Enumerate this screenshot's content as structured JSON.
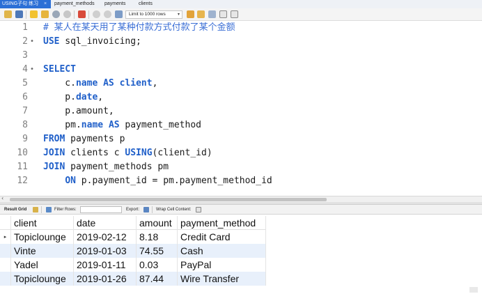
{
  "tabs": [
    {
      "label": "USING子句 练习",
      "active": true,
      "close": "×"
    },
    {
      "label": "payment_methods",
      "active": false
    },
    {
      "label": "payments",
      "active": false
    },
    {
      "label": "clients",
      "active": false
    }
  ],
  "toolbar": {
    "limit_label": "Limit to 1000 rows",
    "icons": [
      "folder-open-icon",
      "save-icon",
      "execute-icon",
      "execute-current-icon",
      "explain-icon",
      "stop-icon",
      "toggle-autocommit-icon",
      "commit-icon",
      "rollback-icon",
      "toggle-output-icon",
      "beautify-icon",
      "find-icon",
      "invisible-chars-icon",
      "wrap-icon"
    ]
  },
  "editor": {
    "lines": [
      {
        "n": "1",
        "fold": "",
        "html": "<span class='cm'># 某人在某天用了某种付款方式付款了某个金额</span>"
      },
      {
        "n": "2",
        "fold": "•",
        "html": "<span class='kw'>USE</span> sql_invoicing;"
      },
      {
        "n": "3",
        "fold": "",
        "html": ""
      },
      {
        "n": "4",
        "fold": "•",
        "html": "<span class='kw'>SELECT</span>"
      },
      {
        "n": "5",
        "fold": "",
        "html": "    c.<span class='kw'>name</span> <span class='kw'>AS</span> <span class='kw'>client</span>,"
      },
      {
        "n": "6",
        "fold": "",
        "html": "    p.<span class='kw'>date</span>,"
      },
      {
        "n": "7",
        "fold": "",
        "html": "    p.amount,"
      },
      {
        "n": "8",
        "fold": "",
        "html": "    pm.<span class='kw'>name</span> <span class='kw'>AS</span> payment_method"
      },
      {
        "n": "9",
        "fold": "",
        "html": "<span class='kw'>FROM</span> payments p"
      },
      {
        "n": "10",
        "fold": "",
        "html": "<span class='kw'>JOIN</span> clients c <span class='kw'>USING</span>(client_id)"
      },
      {
        "n": "11",
        "fold": "",
        "html": "<span class='kw'>JOIN</span> payment_methods pm"
      },
      {
        "n": "12",
        "fold": "",
        "html": "    <span class='kw'>ON</span> p.payment_id = pm.payment_method_id"
      }
    ]
  },
  "result_toolbar": {
    "result_grid": "Result Grid",
    "filter_rows": "Filter Rows:",
    "export": "Export:",
    "wrap_cell": "Wrap Cell Content:"
  },
  "grid": {
    "columns": [
      "client",
      "date",
      "amount",
      "payment_method"
    ],
    "rows": [
      [
        "Topiclounge",
        "2019-02-12",
        "8.18",
        "Credit Card"
      ],
      [
        "Vinte",
        "2019-01-03",
        "74.55",
        "Cash"
      ],
      [
        "Yadel",
        "2019-01-11",
        "0.03",
        "PayPal"
      ],
      [
        "Topiclounge",
        "2019-01-26",
        "87.44",
        "Wire Transfer"
      ]
    ],
    "current_row_marker": "▸"
  },
  "colors": {
    "keyword": "#1f5fc9",
    "comment": "#3b6fd6",
    "active_tab": "#2b6fd6",
    "alt_row": "#e8f0fb"
  }
}
